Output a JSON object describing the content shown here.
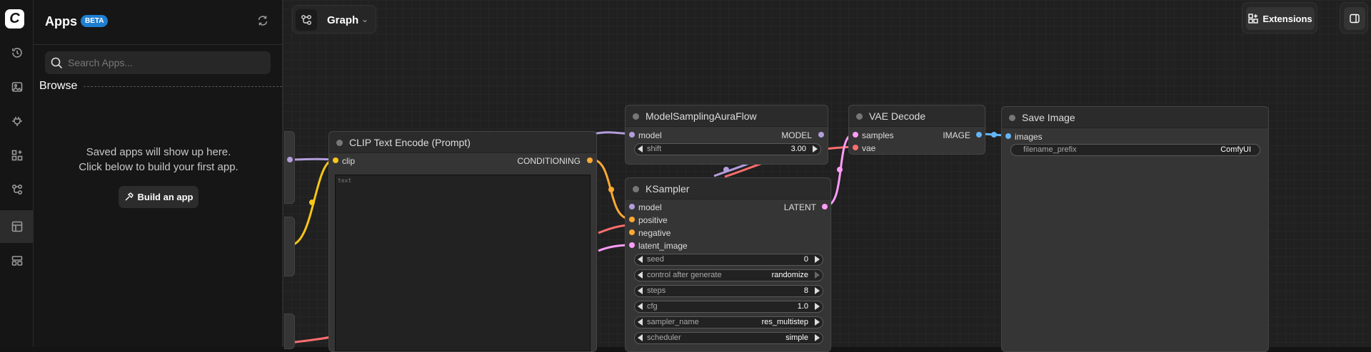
{
  "apps_panel": {
    "title": "Apps",
    "badge": "BETA",
    "search_placeholder": "Search Apps...",
    "browse_label": "Browse",
    "empty_line1": "Saved apps will show up here.",
    "empty_line2": "Click below to build your first app.",
    "build_button": "Build an app"
  },
  "topbar": {
    "graph_tab": "Graph",
    "extensions_button": "Extensions"
  },
  "nodes": {
    "clip": {
      "title": "CLIP Text Encode (Prompt)",
      "input": "clip",
      "output": "CONDITIONING",
      "text_placeholder": "text"
    },
    "msaf": {
      "title": "ModelSamplingAuraFlow",
      "input": "model",
      "output": "MODEL",
      "shift_label": "shift",
      "shift_value": "3.00"
    },
    "ksampler": {
      "title": "KSampler",
      "inputs": [
        "model",
        "positive",
        "negative",
        "latent_image"
      ],
      "output": "LATENT",
      "widgets": [
        {
          "label": "seed",
          "value": "0"
        },
        {
          "label": "control after generate",
          "value": "randomize"
        },
        {
          "label": "steps",
          "value": "8"
        },
        {
          "label": "cfg",
          "value": "1.0"
        },
        {
          "label": "sampler_name",
          "value": "res_multistep"
        },
        {
          "label": "scheduler",
          "value": "simple"
        }
      ]
    },
    "vae": {
      "title": "VAE Decode",
      "inputs": [
        "samples",
        "vae"
      ],
      "output": "IMAGE"
    },
    "save": {
      "title": "Save Image",
      "input": "images",
      "widget_label": "filename_prefix",
      "widget_value": "ComfyUI"
    }
  },
  "colors": {
    "clip": "#f5c518",
    "model": "#b39ddb",
    "conditioning": "#ffa931",
    "latent": "#ff9cf9",
    "vae": "#ff6e6e",
    "image": "#64b5f6"
  }
}
